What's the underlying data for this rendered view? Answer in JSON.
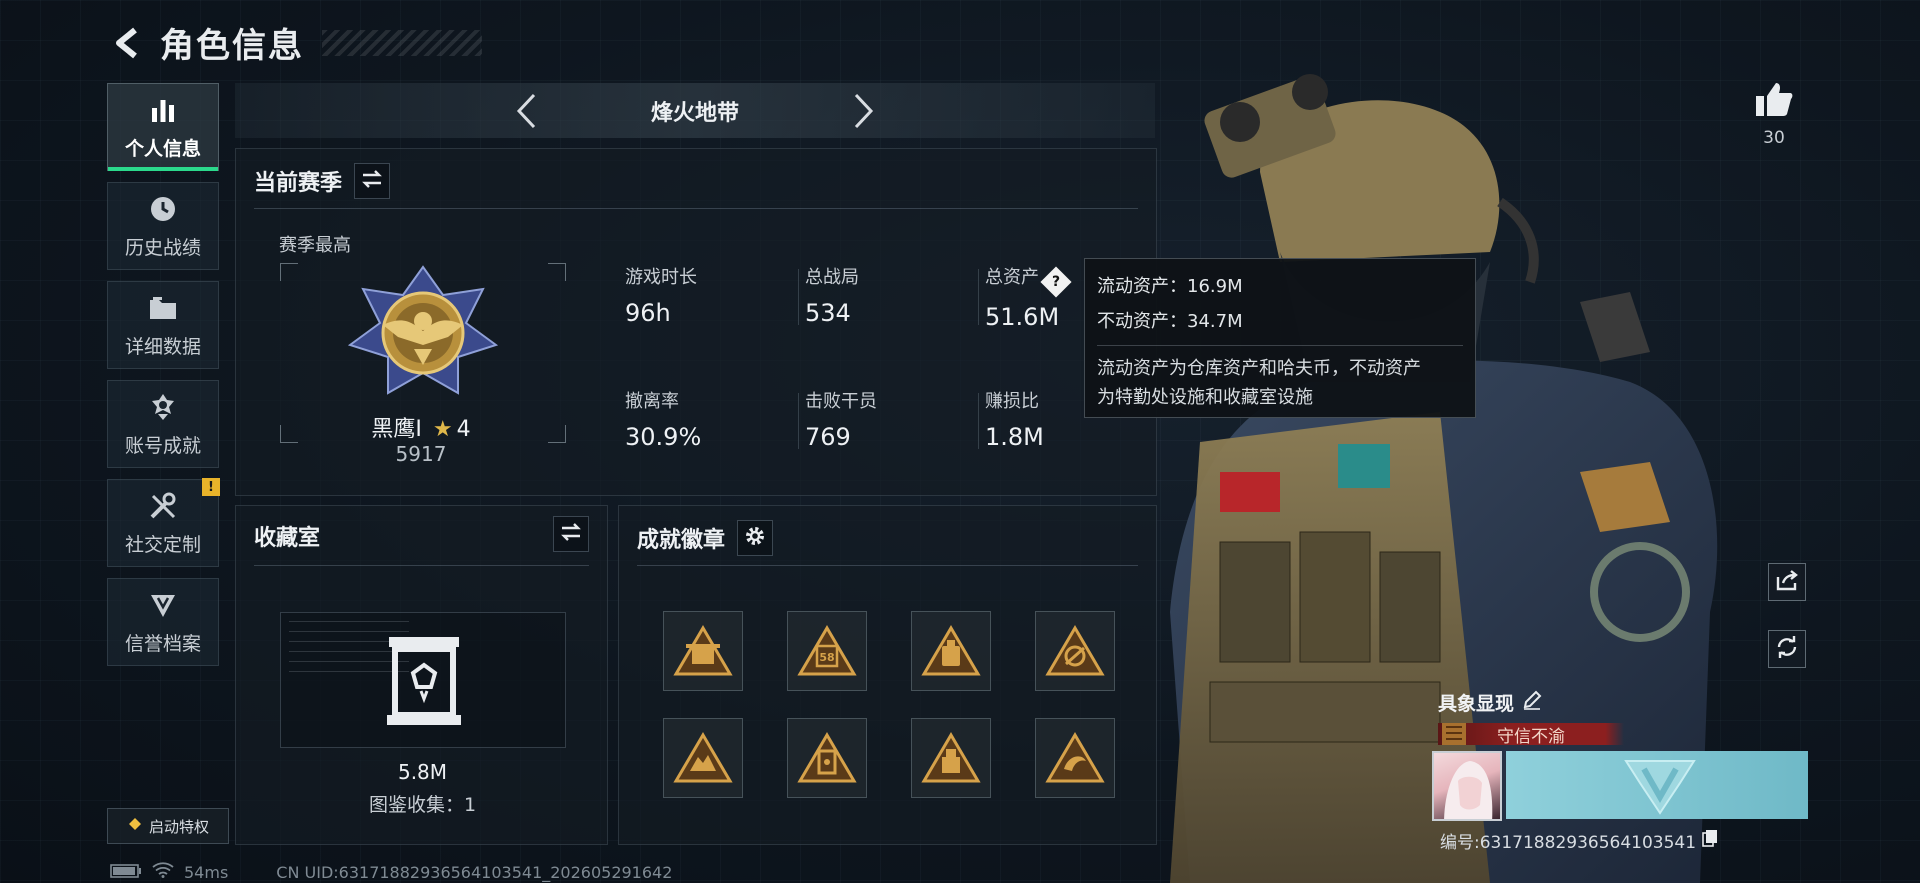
{
  "header": {
    "title": "角色信息"
  },
  "sidebar": {
    "items": [
      {
        "label": "个人信息",
        "icon": "bar-chart-icon",
        "active": true
      },
      {
        "label": "历史战绩",
        "icon": "clock-icon"
      },
      {
        "label": "详细数据",
        "icon": "folder-icon"
      },
      {
        "label": "账号成就",
        "icon": "medal-icon"
      },
      {
        "label": "社交定制",
        "icon": "tools-icon",
        "badge": "!"
      },
      {
        "label": "信誉档案",
        "icon": "shield-emblem-icon"
      }
    ],
    "privilege_label": "启动特权"
  },
  "mode": {
    "title": "烽火地带"
  },
  "season": {
    "title": "当前赛季",
    "best_label": "赛季最高",
    "rank_name": "黑鹰I",
    "rank_stars": "4",
    "rank_score": "5917",
    "stats": [
      {
        "label": "游戏时长",
        "value": "96h"
      },
      {
        "label": "总战局",
        "value": "534"
      },
      {
        "label": "总资产",
        "value": "51.6M",
        "help": true
      },
      {
        "label": "撤离率",
        "value": "30.9%"
      },
      {
        "label": "击败干员",
        "value": "769"
      },
      {
        "label": "赚损比",
        "value": "1.8M"
      }
    ]
  },
  "tooltip": {
    "liquid": "流动资产：16.9M",
    "fixed": "不动资产：34.7M",
    "desc_line1": "流动资产为仓库资产和哈夫币，不动资产",
    "desc_line2": "为特勤处设施和收藏室设施"
  },
  "collection": {
    "title": "收藏室",
    "value": "5.8M",
    "count": "图鉴收集：1"
  },
  "achievements": {
    "title": "成就徽章",
    "badges": [
      "badge-1",
      "badge-2",
      "badge-3",
      "badge-4",
      "badge-5",
      "badge-6",
      "badge-7",
      "badge-8"
    ],
    "badge_58_text": "58"
  },
  "like": {
    "count": "30"
  },
  "avatar": {
    "title": "具象显现",
    "honor": "守信不渝",
    "serial": "编号:63171882936564103541"
  },
  "footer": {
    "ping": "54ms",
    "uid": "CN UID:63171882936564103541_202605291642"
  },
  "colors": {
    "accent_green": "#2bd98c",
    "badge_gold": "#c9953f",
    "honor_red": "#8c1f1f",
    "warn_yellow": "#e8b32a"
  }
}
